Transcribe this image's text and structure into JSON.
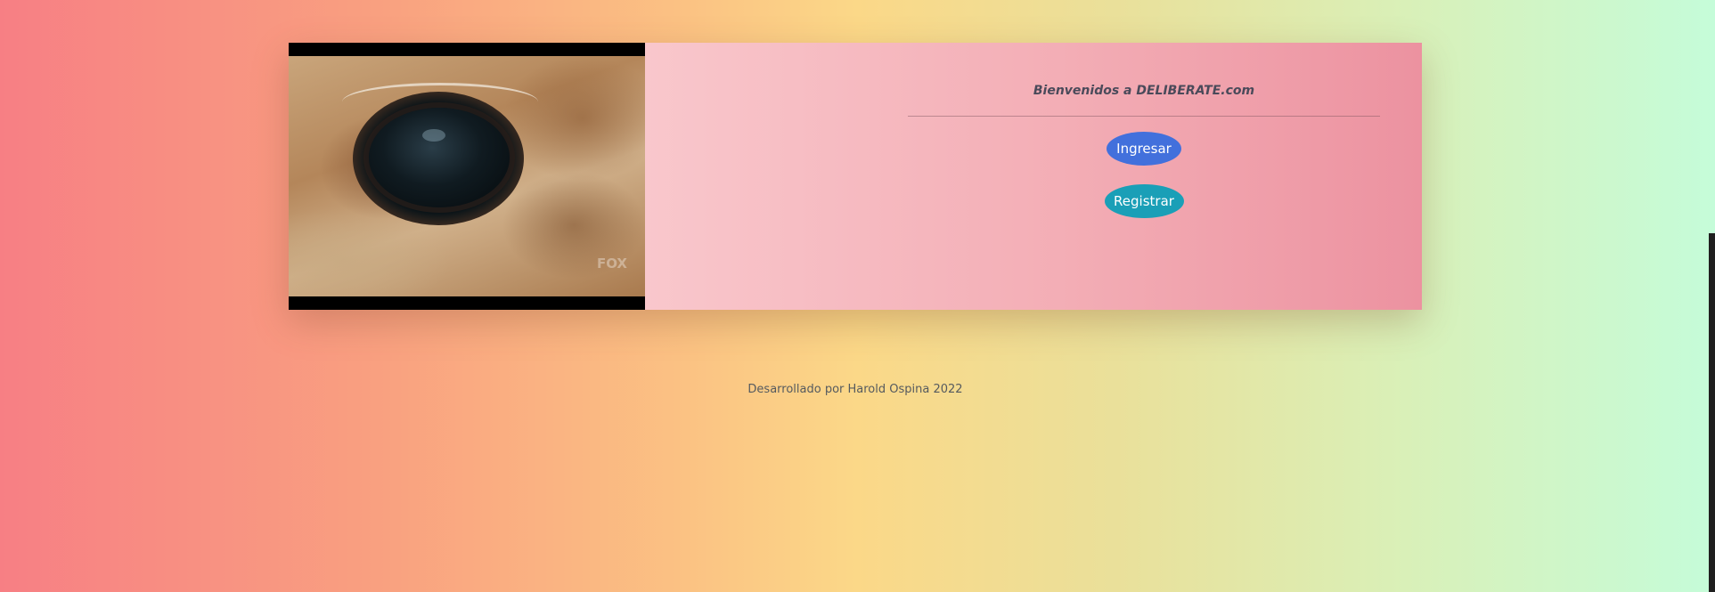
{
  "hero": {
    "image_watermark": "FOX",
    "welcome_text": "Bienvenidos a DELIBERATE.com",
    "login_button": "Ingresar",
    "register_button": "Registrar"
  },
  "footer": {
    "credit": "Desarrollado por Harold Ospina 2022"
  },
  "colors": {
    "login_button": "#4270dc",
    "register_button": "#1a9fb7",
    "panel_start": "#f9c7cc",
    "panel_end": "#ec92a0"
  }
}
